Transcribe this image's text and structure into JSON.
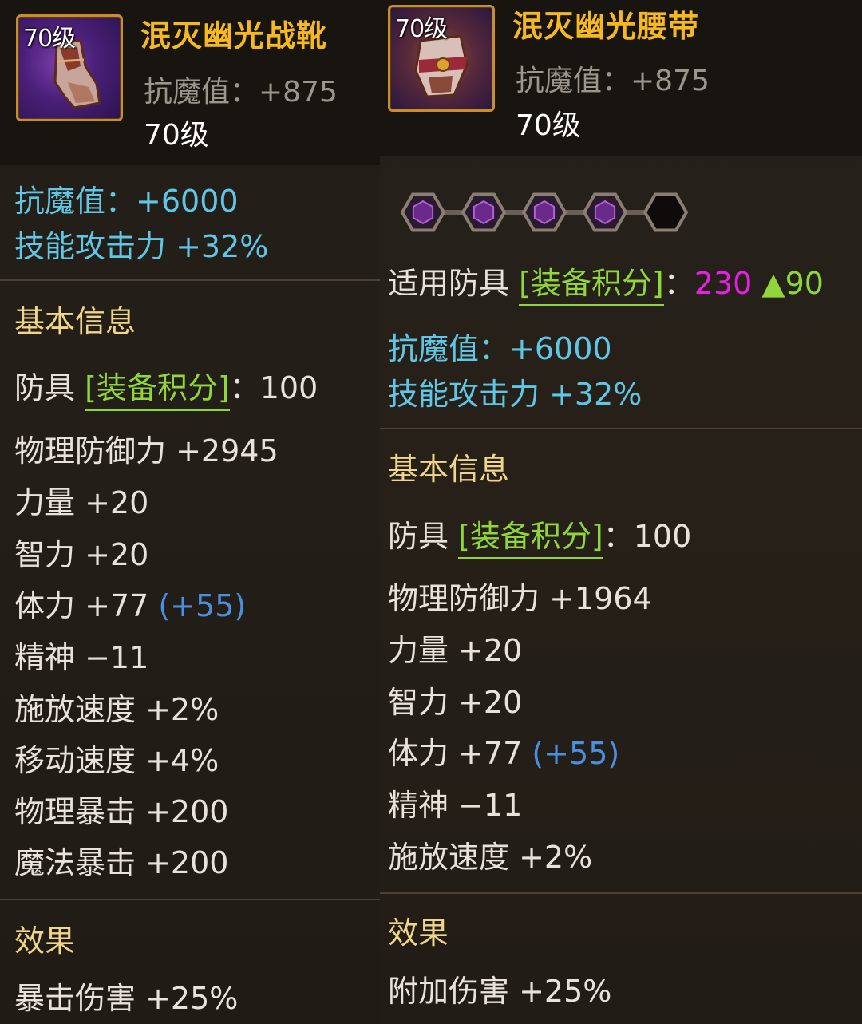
{
  "left": {
    "level_badge": "70级",
    "name": "泯灭幽光战靴",
    "header_stat": "抗魔值：+875",
    "header_level": "70级",
    "stats_cyan": [
      "抗魔值：+6000",
      "技能攻击力 +32%"
    ],
    "basic_title": "基本信息",
    "score_prefix": "防具 ",
    "score_label": "[装备积分]",
    "score_suffix": "：100",
    "basic_lines": [
      "物理防御力 +2945",
      "力量 +20",
      "智力 +20"
    ],
    "vit_text": "体力 +77 ",
    "vit_bonus": "(+55)",
    "basic_lines2": [
      "精神 −11",
      "施放速度 +2%",
      "移动速度 +4%",
      "物理暴击 +200",
      "魔法暴击 +200"
    ],
    "effect_title": "效果",
    "effect_line": "暴击伤害 +25%"
  },
  "right": {
    "level_badge": "70级",
    "name": "泯灭幽光腰带",
    "header_stat": "抗魔值：+875",
    "header_level": "70级",
    "gems": [
      {
        "filled": true
      },
      {
        "filled": true
      },
      {
        "filled": true
      },
      {
        "filled": true
      },
      {
        "filled": false
      }
    ],
    "applicable_prefix": "适用防具 ",
    "applicable_label": "[装备积分]",
    "applicable_colon": "：",
    "applicable_value": "230",
    "applicable_up": " ▲90",
    "stats_cyan": [
      "抗魔值：+6000",
      "技能攻击力 +32%"
    ],
    "basic_title": "基本信息",
    "score_prefix": "防具 ",
    "score_label": "[装备积分]",
    "score_suffix": "：100",
    "basic_lines": [
      "物理防御力 +1964",
      "力量 +20",
      "智力 +20"
    ],
    "vit_text": "体力 +77 ",
    "vit_bonus": "(+55)",
    "basic_lines2": [
      "精神 −11",
      "施放速度 +2%"
    ],
    "effect_title": "效果",
    "effect_line": "附加伤害 +25%"
  },
  "colors": {
    "item_name": "#f5b91f",
    "cyan_stat": "#5fc6e6",
    "section_title": "#f0d68a",
    "score_label": "#8fd63a",
    "bonus": "#4a8fe0",
    "score_total": "#e61fe0",
    "gem_filled": "#6a2a8a"
  }
}
